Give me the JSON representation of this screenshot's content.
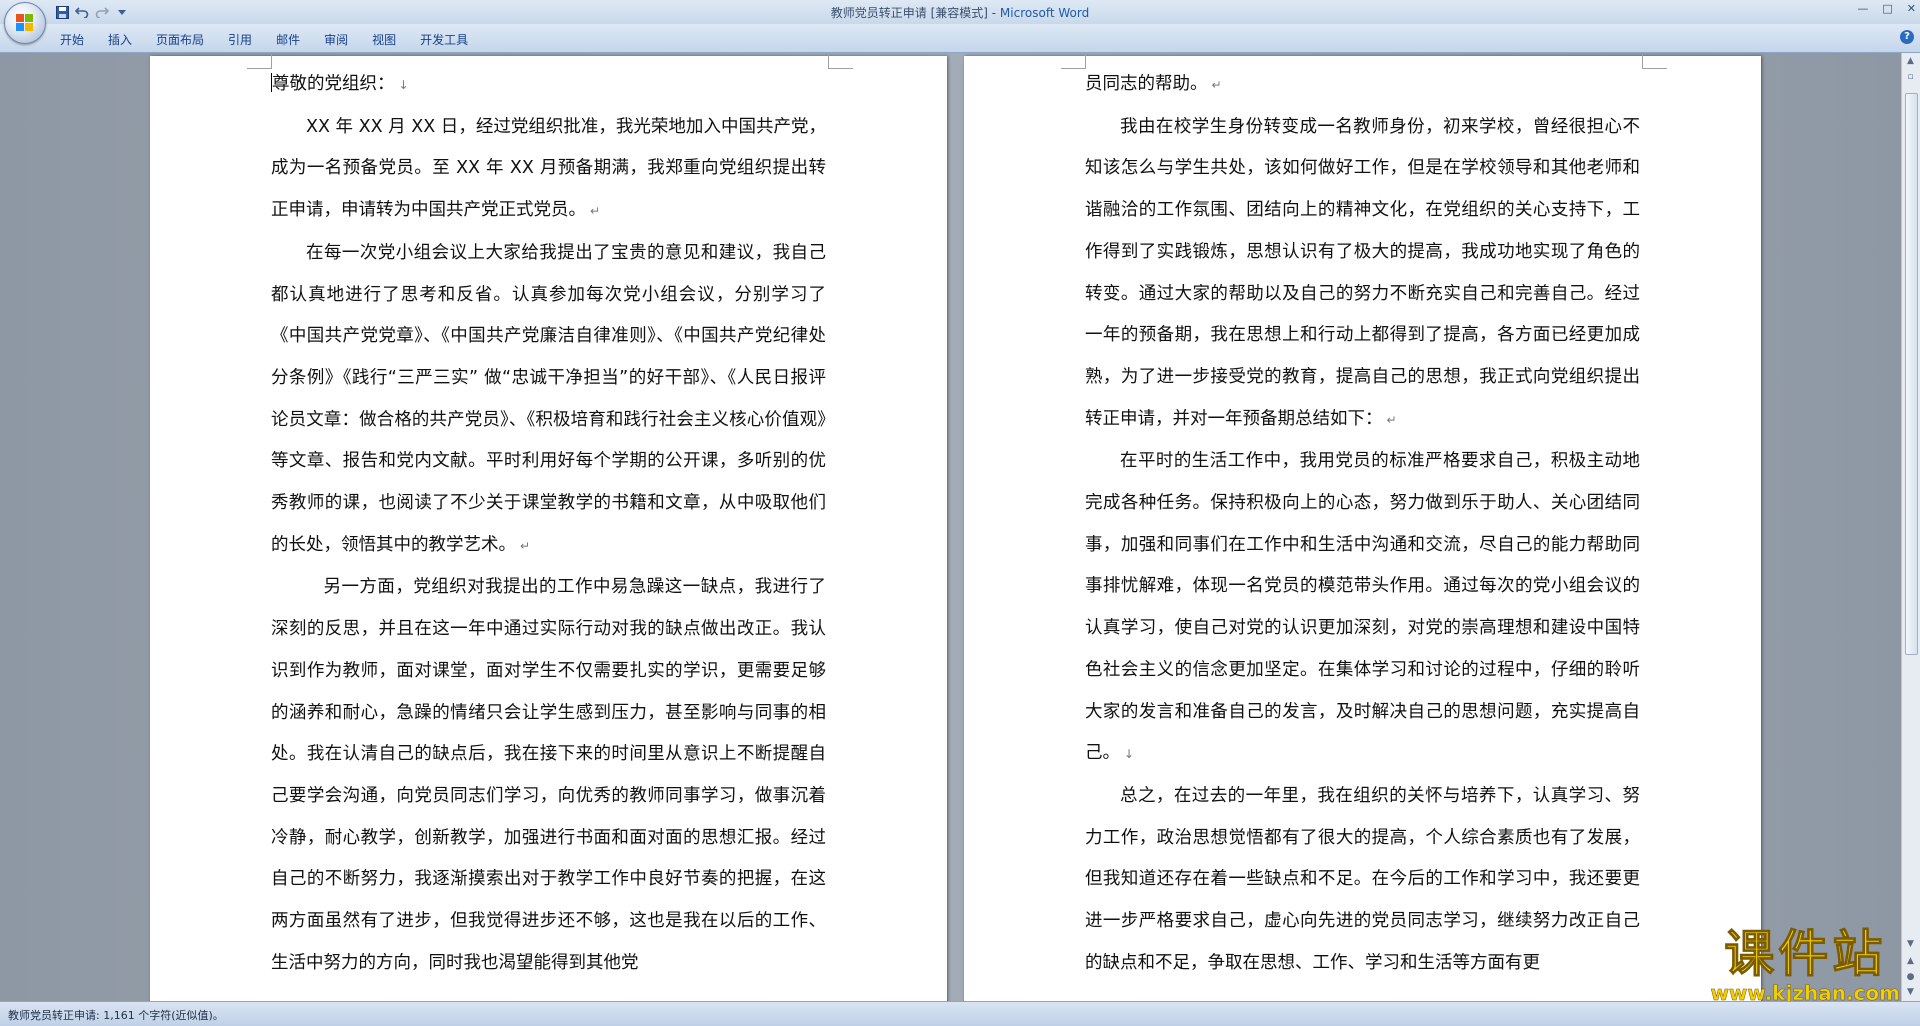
{
  "window": {
    "title_doc": "教师党员转正申请 [兼容模式] - ",
    "title_app": "Microsoft Word",
    "controls": [
      "—",
      "□",
      "✕"
    ]
  },
  "quick_access": [
    "save-icon",
    "undo-icon",
    "redo-icon",
    "customize-icon"
  ],
  "ribbon": {
    "tabs": [
      "开始",
      "插入",
      "页面布局",
      "引用",
      "邮件",
      "审阅",
      "视图",
      "开发工具"
    ],
    "help": "?"
  },
  "document": {
    "left_page": [
      "尊敬的党组织：",
      "XX 年 XX 月 XX 日，经过党组织批准，我光荣地加入中国共产党，成为一名预备党员。至 XX 年 XX 月预备期满，我郑重向党组织提出转正申请，申请转为中国共产党正式党员。",
      "在每一次党小组会议上大家给我提出了宝贵的意见和建议，我自己都认真地进行了思考和反省。认真参加每次党小组会议，分别学习了《中国共产党党章》、《中国共产党廉洁自律准则》、《中国共产党纪律处分条例》《践行“三严三实” 做“忠诚干净担当”的好干部》、《人民日报评论员文章：做合格的共产党员》、《积极培育和践行社会主义核心价值观》等文章、报告和党内文献。平时利用好每个学期的公开课，多听别的优秀教师的课，也阅读了不少关于课堂教学的书籍和文章，从中吸取他们的长处，领悟其中的教学艺术。",
      "另一方面，党组织对我提出的工作中易急躁这一缺点，我进行了深刻的反思，并且在这一年中通过实际行动对我的缺点做出改正。我认识到作为教师，面对课堂，面对学生不仅需要扎实的学识，更需要足够的涵养和耐心，急躁的情绪只会让学生感到压力，甚至影响与同事的相处。我在认清自己的缺点后，我在接下来的时间里从意识上不断提醒自己要学会沟通，向党员同志们学习，向优秀的教师同事学习，做事沉着冷静，耐心教学，创新教学，加强进行书面和面对面的思想汇报。经过自己的不断努力，我逐渐摸索出对于教学工作中良好节奏的把握，在这两方面虽然有了进步，但我觉得进步还不够，这也是我在以后的工作、生活中努力的方向，同时我也渴望能得到其他党"
    ],
    "right_page": [
      "员同志的帮助。",
      "我由在校学生身份转变成一名教师身份，初来学校，曾经很担心不知该怎么与学生共处，该如何做好工作，但是在学校领导和其他老师和谐融洽的工作氛围、团结向上的精神文化，在党组织的关心支持下，工作得到了实践锻炼，思想认识有了极大的提高，我成功地实现了角色的转变。通过大家的帮助以及自己的努力不断充实自己和完善自己。经过一年的预备期，我在思想上和行动上都得到了提高，各方面已经更加成熟，为了进一步接受党的教育，提高自己的思想，我正式向党组织提出转正申请，并对一年预备期总结如下：",
      "在平时的生活工作中，我用党员的标准严格要求自己，积极主动地完成各种任务。保持积极向上的心态，努力做到乐于助人、关心团结同事，加强和同事们在工作中和生活中沟通和交流，尽自己的能力帮助同事排忧解难，体现一名党员的模范带头作用。通过每次的党小组会议的认真学习，使自己对党的认识更加深刻，对党的崇高理想和建设中国特色社会主义的信念更加坚定。在集体学习和讨论的过程中，仔细的聆听大家的发言和准备自己的发言，及时解决自己的思想问题，充实提高自己。",
      "总之，在过去的一年里，我在组织的关怀与培养下，认真学习、努力工作，政治思想觉悟都有了很大的提高，个人综合素质也有了发展，但我知道还存在着一些缺点和不足。在今后的工作和学习中，我还要更进一步严格要求自己，虚心向先进的党员同志学习，继续努力改正自己的缺点和不足，争取在思想、工作、学习和生活等方面有更"
    ]
  },
  "status": {
    "text": "教师党员转正申请: 1,161 个字符(近似值)。"
  },
  "watermark": {
    "big": "课件站",
    "small": "www.kjzhan.com"
  },
  "colors": {
    "ribbon_text": "#15428b",
    "app_name": "#1e5ca8",
    "watermark": "#f4d000"
  }
}
